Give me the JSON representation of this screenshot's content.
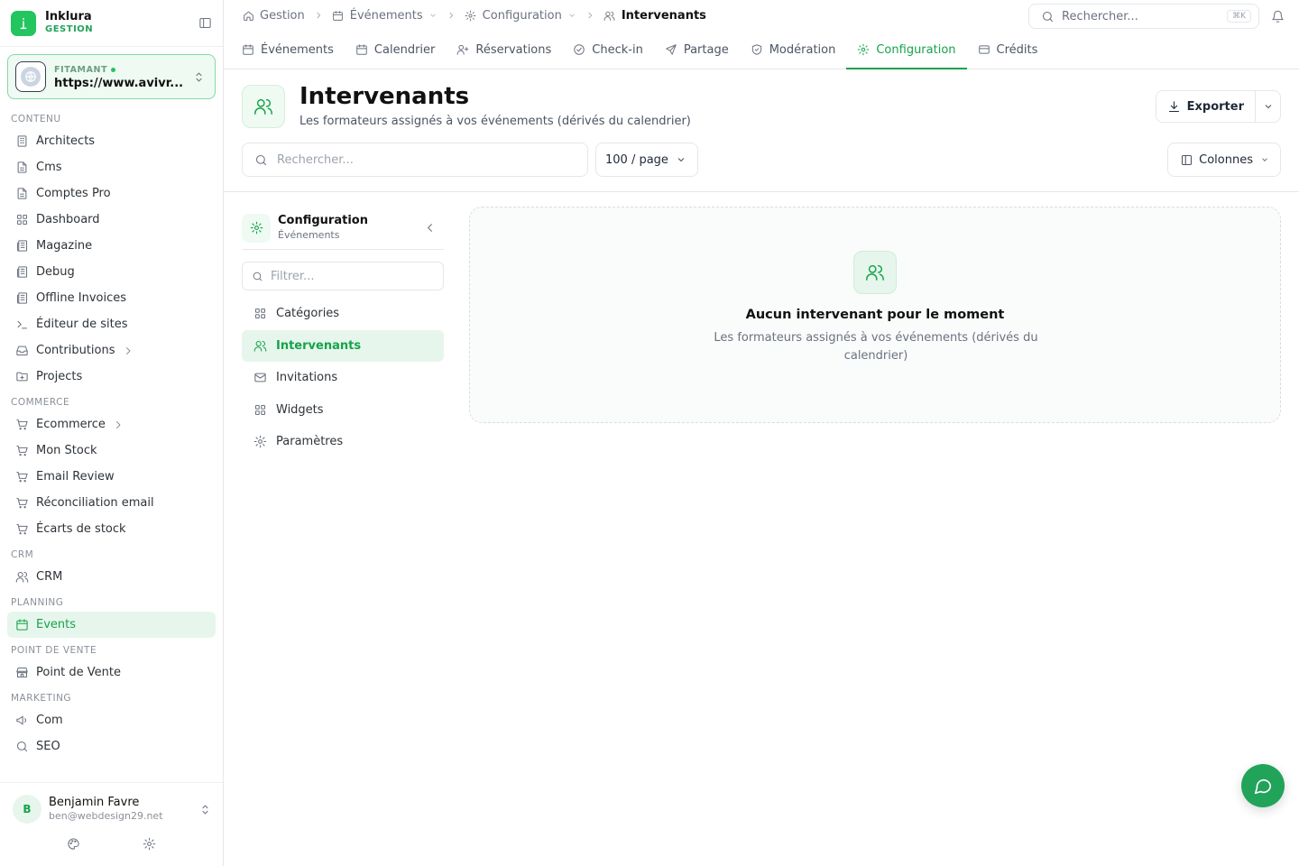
{
  "colors": {
    "accent": "#16a34a",
    "accent_bg": "#e6f6ec",
    "border": "#e5e7eb"
  },
  "brand": {
    "name": "Inklura",
    "subtitle": "GESTION"
  },
  "site": {
    "label": "FITAMANT",
    "url": "https://www.avivr..."
  },
  "sidebar": {
    "sections": [
      {
        "label": "CONTENU",
        "items": [
          {
            "label": "Architects",
            "icon": "building-icon"
          },
          {
            "label": "Cms",
            "icon": "file-icon"
          },
          {
            "label": "Comptes Pro",
            "icon": "file-icon"
          },
          {
            "label": "Dashboard",
            "icon": "grid-icon"
          },
          {
            "label": "Magazine",
            "icon": "newspaper-icon"
          },
          {
            "label": "Debug",
            "icon": "newspaper-icon"
          },
          {
            "label": "Offline Invoices",
            "icon": "newspaper-icon"
          },
          {
            "label": "Éditeur de sites",
            "icon": "terminal-icon"
          },
          {
            "label": "Contributions",
            "icon": "inbox-icon",
            "expandable": true
          },
          {
            "label": "Projects",
            "icon": "folder-icon"
          }
        ]
      },
      {
        "label": "COMMERCE",
        "items": [
          {
            "label": "Ecommerce",
            "icon": "cart-icon",
            "expandable": true
          },
          {
            "label": "Mon Stock",
            "icon": "cart-icon"
          },
          {
            "label": "Email Review",
            "icon": "cart-icon"
          },
          {
            "label": "Réconciliation email",
            "icon": "cart-icon"
          },
          {
            "label": "Écarts de stock",
            "icon": "cart-icon"
          }
        ]
      },
      {
        "label": "CRM",
        "items": [
          {
            "label": "CRM",
            "icon": "users-icon"
          }
        ]
      },
      {
        "label": "PLANNING",
        "items": [
          {
            "label": "Events",
            "icon": "calendar-icon",
            "active": true
          }
        ]
      },
      {
        "label": "POINT DE VENTE",
        "items": [
          {
            "label": "Point de Vente",
            "icon": "store-icon"
          }
        ]
      },
      {
        "label": "MARKETING",
        "items": [
          {
            "label": "Com",
            "icon": "megaphone-icon"
          },
          {
            "label": "SEO",
            "icon": "search-icon"
          }
        ]
      }
    ]
  },
  "user": {
    "initial": "B",
    "name": "Benjamin Favre",
    "email": "ben@webdesign29.net"
  },
  "breadcrumb": {
    "home": "Gestion",
    "events": "Événements",
    "config": "Configuration",
    "current": "Intervenants"
  },
  "search": {
    "placeholder": "Rechercher...",
    "shortcut": "⌘K"
  },
  "tabs": [
    {
      "label": "Événements",
      "icon": "calendar-icon"
    },
    {
      "label": "Calendrier",
      "icon": "calendar-icon"
    },
    {
      "label": "Réservations",
      "icon": "user-plus-icon"
    },
    {
      "label": "Check-in",
      "icon": "check-circle-icon"
    },
    {
      "label": "Partage",
      "icon": "send-icon"
    },
    {
      "label": "Modération",
      "icon": "shield-check-icon"
    },
    {
      "label": "Configuration",
      "icon": "gear-icon",
      "active": true
    },
    {
      "label": "Crédits",
      "icon": "credit-card-icon"
    }
  ],
  "page": {
    "title": "Intervenants",
    "subtitle": "Les formateurs assignés à vos événements (dérivés du calendrier)",
    "export_label": "Exporter",
    "search_placeholder": "Rechercher...",
    "per_page": "100 / page",
    "columns_label": "Colonnes"
  },
  "config_panel": {
    "title": "Configuration",
    "subtitle": "Événements",
    "filter_placeholder": "Filtrer...",
    "items": [
      {
        "label": "Catégories",
        "icon": "grid-icon"
      },
      {
        "label": "Intervenants",
        "icon": "users-icon",
        "active": true
      },
      {
        "label": "Invitations",
        "icon": "mail-icon"
      },
      {
        "label": "Widgets",
        "icon": "grid-icon"
      },
      {
        "label": "Paramètres",
        "icon": "gear-icon"
      }
    ]
  },
  "empty_state": {
    "title": "Aucun intervenant pour le moment",
    "description": "Les formateurs assignés à vos événements (dérivés du calendrier)"
  }
}
